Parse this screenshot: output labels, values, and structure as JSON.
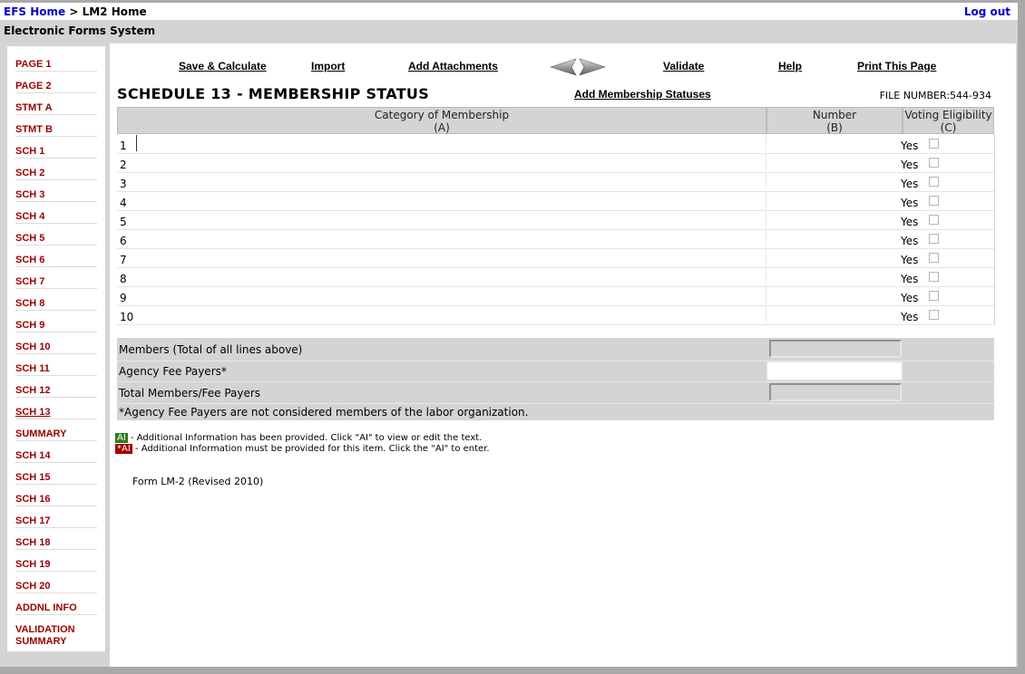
{
  "header": {
    "efs_home": "EFS Home",
    "separator": " > ",
    "lm2_home": "LM2 Home",
    "logout": "Log out",
    "system_title": "Electronic Forms System"
  },
  "sidebar": {
    "items": [
      {
        "label": "PAGE 1"
      },
      {
        "label": "PAGE 2"
      },
      {
        "label": "STMT A"
      },
      {
        "label": "STMT B"
      },
      {
        "label": "SCH 1"
      },
      {
        "label": "SCH 2"
      },
      {
        "label": "SCH 3"
      },
      {
        "label": "SCH 4"
      },
      {
        "label": "SCH 5"
      },
      {
        "label": "SCH 6"
      },
      {
        "label": "SCH 7"
      },
      {
        "label": "SCH 8"
      },
      {
        "label": "SCH 9"
      },
      {
        "label": "SCH 10"
      },
      {
        "label": "SCH 11"
      },
      {
        "label": "SCH 12"
      },
      {
        "label": "SCH 13",
        "active": true
      },
      {
        "label": "SUMMARY"
      },
      {
        "label": "SCH 14"
      },
      {
        "label": "SCH 15"
      },
      {
        "label": "SCH 16"
      },
      {
        "label": "SCH 17"
      },
      {
        "label": "SCH 18"
      },
      {
        "label": "SCH 19"
      },
      {
        "label": "SCH 20"
      },
      {
        "label": "ADDNL INFO"
      },
      {
        "label_line1": "VALIDATION",
        "label_line2": "SUMMARY"
      }
    ]
  },
  "toolbar": {
    "save_calculate": "Save & Calculate",
    "import": "Import",
    "add_attachments": "Add Attachments",
    "prev_icon": "left-arrow-icon",
    "next_icon": "right-arrow-icon",
    "validate": "Validate",
    "help": "Help",
    "print": "Print This Page"
  },
  "schedule": {
    "title": "SCHEDULE 13 - MEMBERSHIP STATUS",
    "add_statuses": "Add Membership Statuses",
    "file_number_label": "FILE NUMBER:",
    "file_number": "544-934"
  },
  "table": {
    "col_a": "Category of Membership",
    "col_a_code": "(A)",
    "col_b": "Number",
    "col_b_code": "(B)",
    "col_c": "Voting Eligibility",
    "col_c_code": "(C)",
    "yes_label": "Yes",
    "rows": [
      {
        "num": "1",
        "category": "",
        "number": "",
        "voting": false
      },
      {
        "num": "2",
        "category": "",
        "number": "",
        "voting": false
      },
      {
        "num": "3",
        "category": "",
        "number": "",
        "voting": false
      },
      {
        "num": "4",
        "category": "",
        "number": "",
        "voting": false
      },
      {
        "num": "5",
        "category": "",
        "number": "",
        "voting": false
      },
      {
        "num": "6",
        "category": "",
        "number": "",
        "voting": false
      },
      {
        "num": "7",
        "category": "",
        "number": "",
        "voting": false
      },
      {
        "num": "8",
        "category": "",
        "number": "",
        "voting": false
      },
      {
        "num": "9",
        "category": "",
        "number": "",
        "voting": false
      },
      {
        "num": "10",
        "category": "",
        "number": "",
        "voting": false
      }
    ]
  },
  "totals": {
    "members_label": "Members (Total of all lines above)",
    "members_value": "",
    "agency_label": "Agency Fee Payers*",
    "agency_value": "",
    "total_label": "Total Members/Fee Payers",
    "total_value": "",
    "footnote": "*Agency Fee Payers are not considered members of the labor organization."
  },
  "legend": {
    "ai_provided_badge": "AI",
    "ai_provided_text": "- Additional Information has been provided. Click \"AI\" to view or edit the text.",
    "ai_required_badge": "*AI",
    "ai_required_text": "- Additional Information must be provided for this item. Click the \"AI\" to enter.",
    "colors": {
      "provided": "#2e7d1b",
      "required": "#9a0000"
    }
  },
  "form_name": "Form LM-2 (Revised 2010)"
}
